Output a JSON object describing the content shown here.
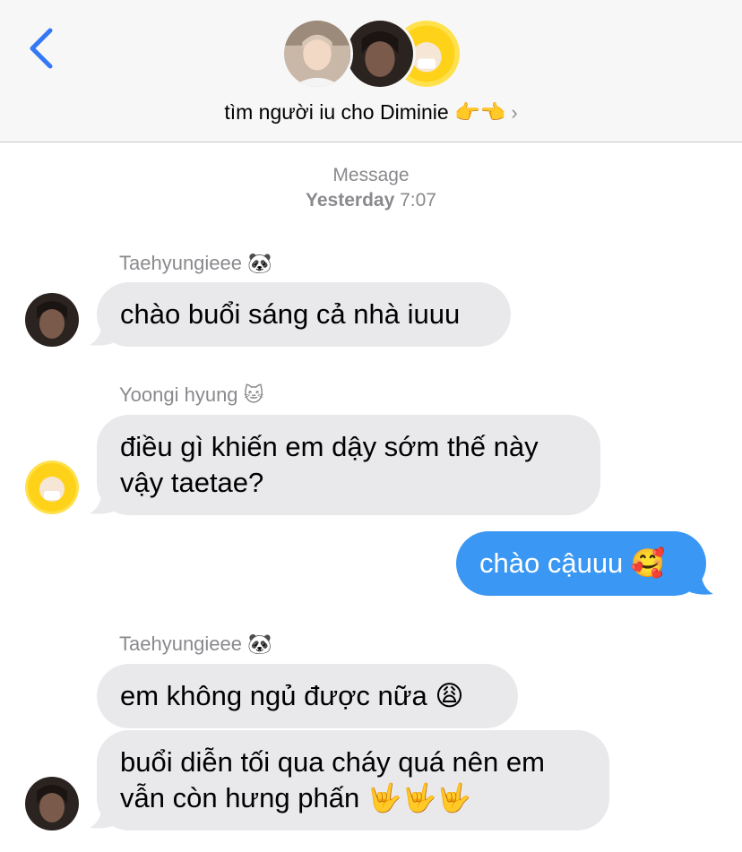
{
  "header": {
    "back_icon": "chevron-left-icon",
    "group_name": "tìm người iu cho Diminie 👉👈",
    "chevron": "›",
    "accent": "#3478f6"
  },
  "timestamp": {
    "label": "Message",
    "day": "Yesterday",
    "time": "7:07"
  },
  "messages": [
    {
      "sender": "Taehyungieee 🐼",
      "text": "chào buổi sáng cả nhà iuuu",
      "direction": "incoming"
    },
    {
      "sender": "Yoongi hyung 🐱",
      "lines": [
        "điều gì khiến em dậy sớm thế này",
        "vậy taetae?"
      ],
      "direction": "incoming"
    },
    {
      "text": "chào cậuuu 🥰",
      "direction": "outgoing"
    },
    {
      "sender": "Taehyungieee 🐼",
      "text": "em không ngủ được nữa 😩",
      "direction": "incoming"
    },
    {
      "lines": [
        "buổi diễn tối qua cháy quá nên em",
        "vẫn còn hưng phấn 🤟🤟🤟"
      ],
      "direction": "incoming"
    }
  ],
  "colors": {
    "incoming_bubble": "#e9e9eb",
    "outgoing_bubble": "#3a97f3",
    "meta_text": "#8a8a8e"
  }
}
